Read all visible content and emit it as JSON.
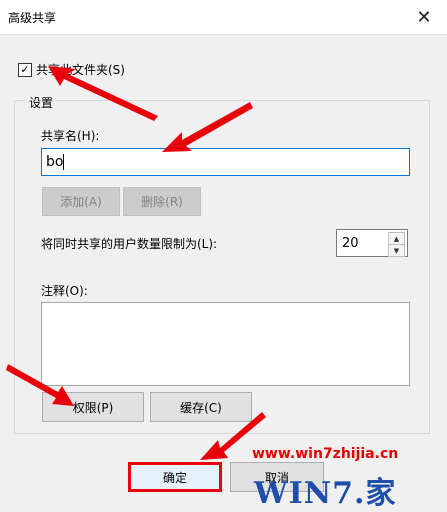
{
  "window": {
    "title": "高级共享",
    "close_glyph": "✕"
  },
  "share_checkbox": {
    "label": "共享此文件夹(S)",
    "checked": true,
    "check_glyph": "✓"
  },
  "settings": {
    "group_label": "设置",
    "share_name_label": "共享名(H):",
    "share_name_value": "bo",
    "add_button": "添加(A)",
    "delete_button": "删除(R)",
    "user_limit_label": "将同时共享的用户数量限制为(L):",
    "user_limit_value": "20",
    "spin_up_glyph": "▲",
    "spin_down_glyph": "▼",
    "comment_label": "注释(O):",
    "comment_value": "",
    "permissions_button": "权限(P)",
    "cache_button": "缓存(C)"
  },
  "footer": {
    "ok_button": "确定",
    "cancel_button": "取消"
  },
  "watermark": {
    "url": "www.win7zhijia.cn",
    "logo_text": "WIN7.家"
  },
  "colors": {
    "annotation_red": "#e8000b",
    "highlight_red": "#e8000b",
    "focus_blue": "#0078d7"
  }
}
